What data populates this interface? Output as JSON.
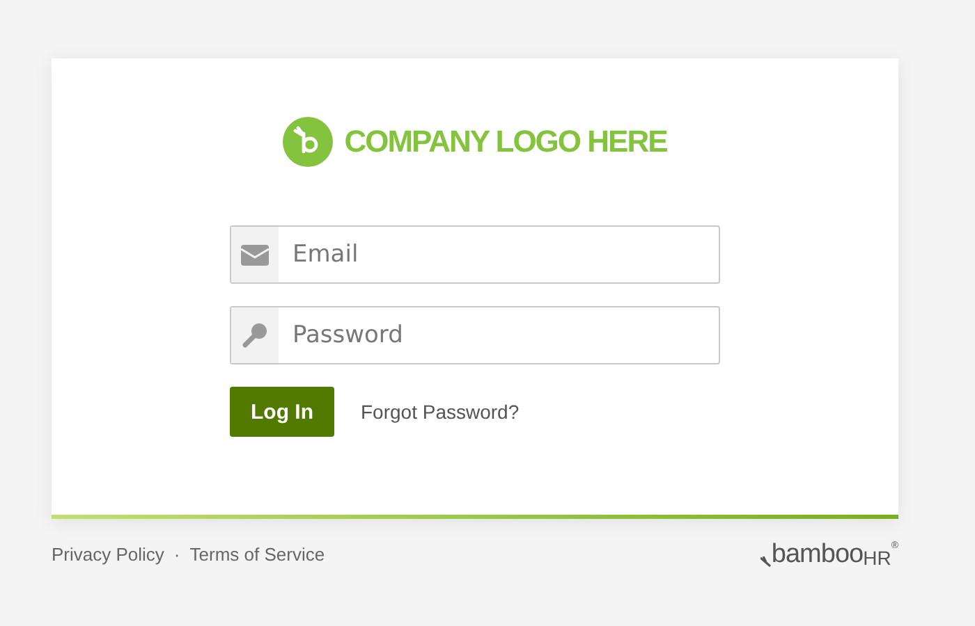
{
  "logo": {
    "text": "COMPANY LOGO HERE"
  },
  "form": {
    "email": {
      "placeholder": "Email"
    },
    "password": {
      "placeholder": "Password"
    },
    "login_button": "Log In",
    "forgot_link": "Forgot Password?"
  },
  "footer": {
    "links": [
      "Privacy Policy",
      "Terms of Service"
    ],
    "separator": "·",
    "brand": {
      "name": "bamboo",
      "suffix": "HR",
      "mark": "®"
    }
  }
}
